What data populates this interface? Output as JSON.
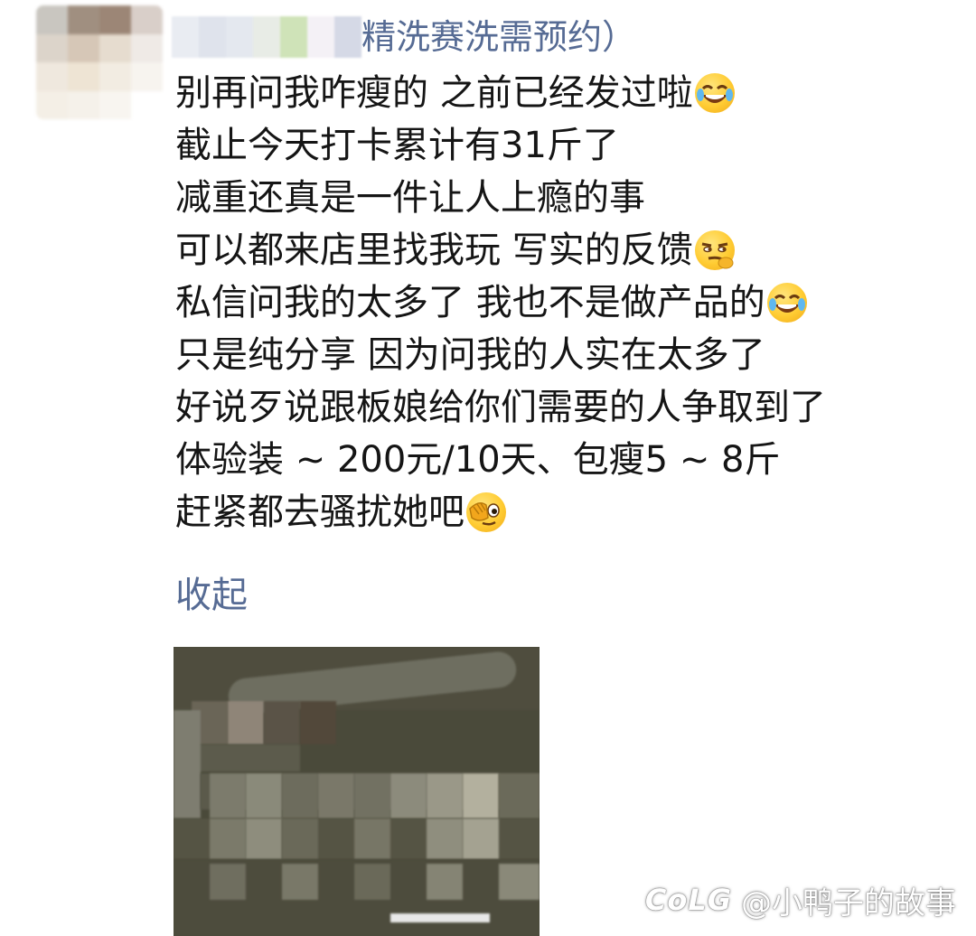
{
  "post": {
    "author_visible_fragment": "精洗赛洗需预约）",
    "lines": [
      "别再问我咋瘦的 之前已经发过啦",
      "截止今天打卡累计有31斤了",
      "减重还真是一件让人上瘾的事",
      "可以都来店里找我玩 写实的反馈",
      "私信问我的太多了 我也不是做产品的",
      "只是纯分享 因为问我的人实在太多了",
      "好说歹说跟板娘给你们需要的人争取到了",
      "体验装 ~ 200元/10天、包瘦5 ~ 8斤",
      "赶紧都去骚扰她吧"
    ],
    "line_emojis": [
      "laugh-cry-emoji",
      "",
      "",
      "smirk-emoji",
      "laugh-cry-emoji",
      "",
      "",
      "",
      "facepalm-peek-emoji"
    ],
    "collapse_label": "收起"
  },
  "watermark": {
    "logo": "CoLG",
    "text": "@小鸭子的故事"
  },
  "colors": {
    "link": "#566b94",
    "text": "#151515",
    "background": "#ffffff"
  }
}
